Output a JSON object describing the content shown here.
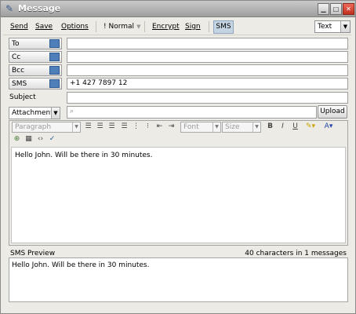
{
  "window": {
    "title": "Message",
    "controls": [
      "minimize",
      "maximize",
      "close"
    ]
  },
  "toolbar": {
    "send": "Send",
    "save": "Save",
    "options": "Options",
    "priority": "Normal",
    "encrypt": "Encrypt",
    "sign": "Sign",
    "sms": "SMS",
    "format": "Text"
  },
  "fields": {
    "to": {
      "label": "To",
      "value": ""
    },
    "cc": {
      "label": "Cc",
      "value": ""
    },
    "bcc": {
      "label": "Bcc",
      "value": ""
    },
    "sms": {
      "label": "SMS",
      "value": "+1 427 7897 12"
    },
    "subject": {
      "label": "Subject",
      "value": ""
    }
  },
  "attachments": {
    "label": "Attachments",
    "upload": "Upload"
  },
  "editor": {
    "paragraph": "Paragraph",
    "font": "Font",
    "size": "Size",
    "body": "Hello John. Will be there in 30 minutes."
  },
  "sms_preview": {
    "label": "SMS Preview",
    "count": "40 characters in 1 messages",
    "text": "Hello John. Will be there in 30 minutes."
  }
}
